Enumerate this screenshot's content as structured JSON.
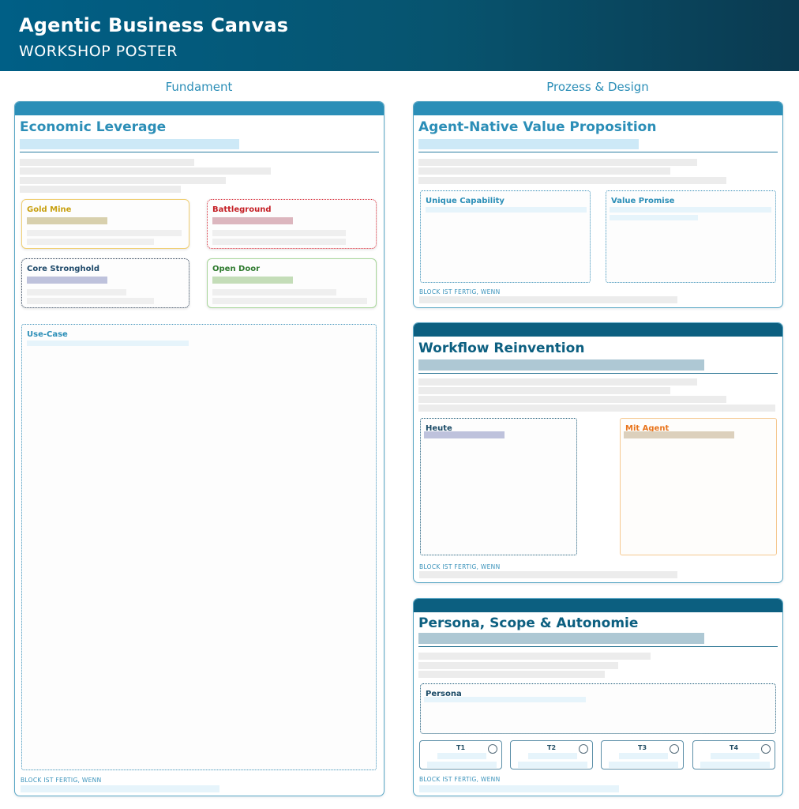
{
  "header": {
    "title": "Agentic Business Canvas",
    "subtitle": "WORKSHOP POSTER"
  },
  "columns": {
    "left": "Fundament",
    "right": "Prozess & Design"
  },
  "colors": {
    "accent": "#2b8eb7",
    "dark_accent": "#0c5f80",
    "header_dark": "#0b3a50"
  },
  "economic_leverage": {
    "title": "Economic Leverage",
    "quadrants": {
      "gold_mine": "Gold Mine",
      "battleground": "Battleground",
      "core_stronghold": "Core Stronghold",
      "open_door": "Open Door"
    },
    "use_case": "Use-Case",
    "done": "BLOCK IST FERTIG, WENN"
  },
  "value_proposition": {
    "title": "Agent-Native Value Proposition",
    "unique_capability": "Unique Capability",
    "value_promise": "Value Promise",
    "done": "BLOCK IST FERTIG, WENN"
  },
  "workflow": {
    "title": "Workflow Reinvention",
    "today": "Heute",
    "with_agent": "Mit Agent",
    "done": "BLOCK IST FERTIG, WENN"
  },
  "persona": {
    "title": "Persona, Scope & Autonomie",
    "persona": "Persona",
    "tiers": [
      "T1",
      "T2",
      "T3",
      "T4"
    ],
    "done": "BLOCK IST FERTIG, WENN"
  }
}
